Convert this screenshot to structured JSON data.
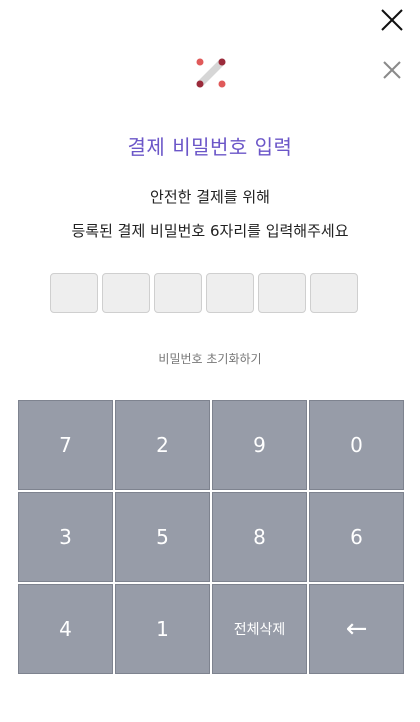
{
  "dialog": {
    "title": "결제 비밀번호 입력",
    "description_line1": "안전한 결제를 위해",
    "description_line2": "등록된 결제 비밀번호 6자리를 입력해주세요",
    "reset_link": "비밀번호 초기화하기",
    "close_icon": "close-icon"
  },
  "pin": {
    "length": 6,
    "entered": 0
  },
  "keypad": {
    "keys": [
      "7",
      "2",
      "9",
      "0",
      "3",
      "5",
      "8",
      "6",
      "4",
      "1",
      "전체삭제",
      "←"
    ]
  },
  "colors": {
    "accent": "#6b56c8",
    "key_bg": "#979ca8",
    "logo_dot": "#e05a5a",
    "logo_dot_dark": "#9b2b3a"
  }
}
